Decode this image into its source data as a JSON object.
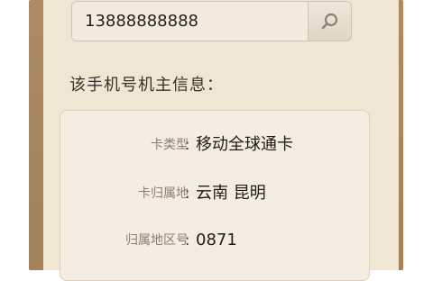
{
  "search": {
    "phone_value": "13888888888",
    "button_icon": "search-icon"
  },
  "owner_info": {
    "heading": "该手机号机主信息：",
    "rows": [
      {
        "label": "卡类型",
        "value": "移动全球通卡"
      },
      {
        "label": "卡归属地",
        "value": "云南 昆明"
      },
      {
        "label": "归属地区号",
        "value": "0871"
      }
    ]
  },
  "colors": {
    "frame": "#a8865e",
    "panel": "#f1e6d4",
    "card": "#f5ede1"
  }
}
